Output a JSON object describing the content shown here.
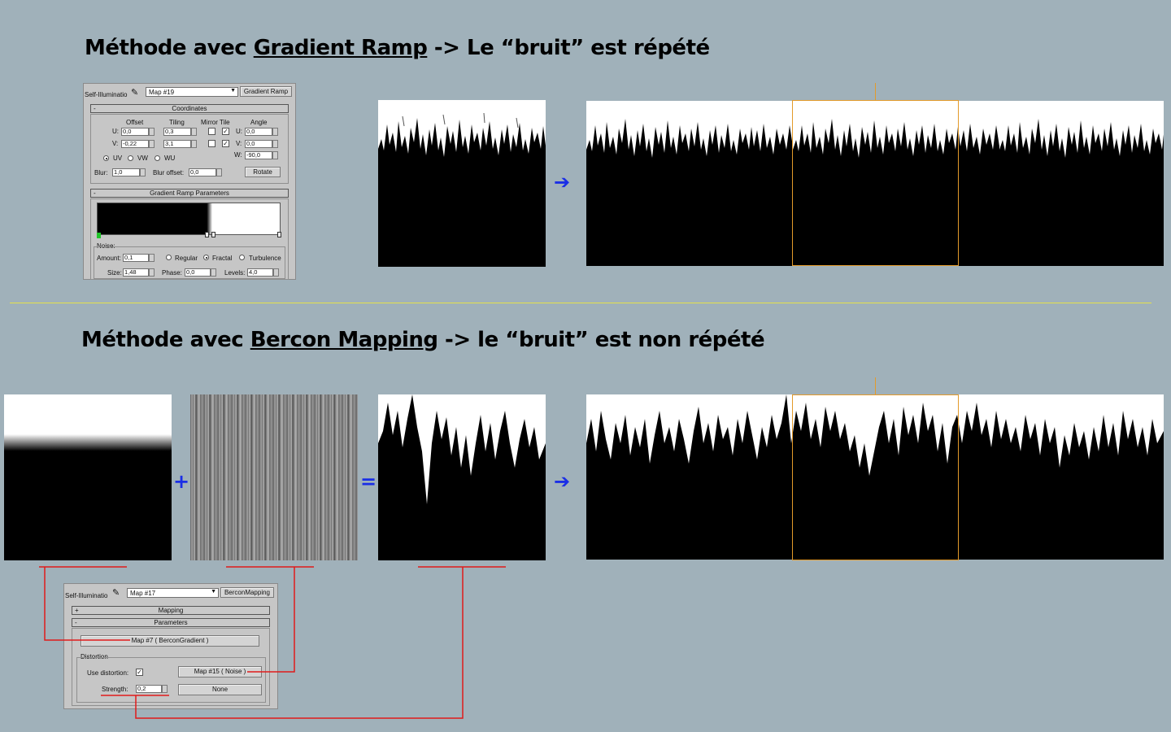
{
  "section1": {
    "title_prefix": "Méthode avec ",
    "title_link": "Gradient Ramp",
    "title_suffix": " -> Le “bruit” est répété"
  },
  "section2": {
    "title_prefix": "Méthode avec ",
    "title_link": "Bercon Mapping",
    "title_suffix": " -> le “bruit” est non répété"
  },
  "panel1": {
    "slot_label": "Self-Illuminatio",
    "map_name": "Map #19",
    "map_type": "Gradient Ramp",
    "coordinates_title": "Coordinates",
    "col_offset": "Offset",
    "col_tiling": "Tiling",
    "col_mirror_tile": "Mirror Tile",
    "col_angle": "Angle",
    "u_label": "U:",
    "v_label": "V:",
    "w_label": "W:",
    "u_offset": "0,0",
    "v_offset": "-0,22",
    "u_tiling": "0,3",
    "v_tiling": "3,1",
    "u_angle": "0,0",
    "v_angle": "0,0",
    "w_angle": "-90,0",
    "uv": "UV",
    "vw": "VW",
    "wu": "WU",
    "blur_label": "Blur:",
    "blur": "1,0",
    "blur_offset_label": "Blur offset:",
    "blur_offset": "0,0",
    "rotate": "Rotate",
    "gradient_params_title": "Gradient Ramp Parameters",
    "noise_label": "Noise:",
    "amount_label": "Amount:",
    "amount": "0,1",
    "regular": "Regular",
    "fractal": "Fractal",
    "turbulence": "Turbulence",
    "size_label": "Size:",
    "size": "1,48",
    "phase_label": "Phase:",
    "phase": "0,0",
    "levels_label": "Levels:",
    "levels": "4,0",
    "collapse_sign": "-",
    "check_mark": "✓"
  },
  "panel2": {
    "slot_label": "Self-Illuminatio",
    "map_name": "Map #17",
    "map_type": "BerconMapping",
    "mapping_title": "Mapping",
    "parameters_title": "Parameters",
    "gradient_map": "Map #7  ( BerconGradient )",
    "distortion_label": "Distortion",
    "use_distortion_label": "Use distortion:",
    "noise_map": "Map #15  ( Noise )",
    "strength_label": "Strength:",
    "strength": "0,2",
    "none_label": "None",
    "expand_sign": "+",
    "collapse_sign": "-",
    "check_mark": "✓"
  },
  "operators": {
    "arrow": "➔",
    "plus": "+",
    "equals": "="
  },
  "colors": {
    "background": "#a0b1ba",
    "divider": "#e6e24a",
    "highlight": "#e39a2a",
    "connector": "#e01b1b",
    "operator": "#1a2ee6"
  }
}
